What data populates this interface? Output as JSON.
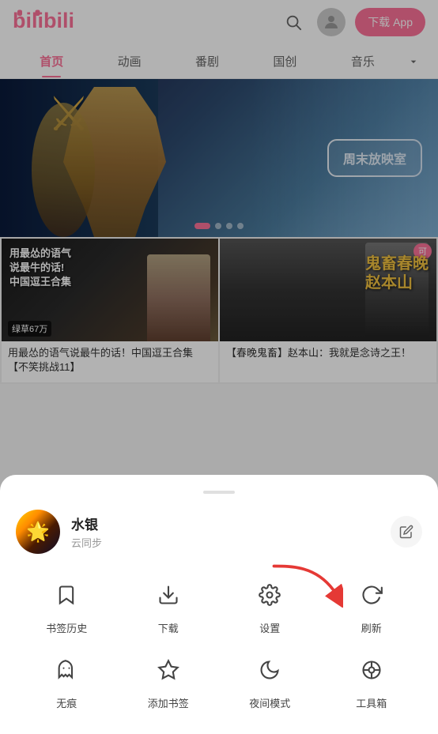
{
  "header": {
    "logo_alt": "bilibili",
    "search_label": "搜索",
    "download_btn": "下载 App",
    "avatar_alt": "用户头像"
  },
  "nav": {
    "tabs": [
      {
        "label": "首页",
        "active": true
      },
      {
        "label": "动画",
        "active": false
      },
      {
        "label": "番剧",
        "active": false
      },
      {
        "label": "国创",
        "active": false
      },
      {
        "label": "音乐",
        "active": false
      }
    ],
    "more": "更多"
  },
  "banner": {
    "badge_line1": "周末放映室",
    "dots": 4,
    "active_dot": 0
  },
  "videos": [
    {
      "title": "用最怂的语气说最牛的话！中国逗王合集【不笑挑战11】",
      "thumb_label": "绿草67万",
      "overlay_text": "用最怂的语气\n说最牛的话!\n中国逗王合集"
    },
    {
      "title": "【春晚鬼畜】赵本山：我就是念诗之王！",
      "badge": "可",
      "yellow_text": "鬼畜春晚\n赵本山"
    }
  ],
  "sheet": {
    "user": {
      "name": "水银",
      "sub": "云同步",
      "avatar_emoji": "🌟"
    },
    "edit_icon": "✏",
    "menu_items": [
      {
        "id": "bookmark",
        "icon": "bookmark",
        "label": "书签历史"
      },
      {
        "id": "download",
        "icon": "download",
        "label": "下载"
      },
      {
        "id": "settings",
        "icon": "settings",
        "label": "设置"
      },
      {
        "id": "refresh",
        "icon": "refresh",
        "label": "刷新"
      },
      {
        "id": "ghost",
        "icon": "ghost",
        "label": "无痕"
      },
      {
        "id": "star",
        "icon": "star",
        "label": "添加书签"
      },
      {
        "id": "night",
        "icon": "night",
        "label": "夜间模式"
      },
      {
        "id": "toolbox",
        "icon": "toolbox",
        "label": "工具箱"
      }
    ]
  }
}
